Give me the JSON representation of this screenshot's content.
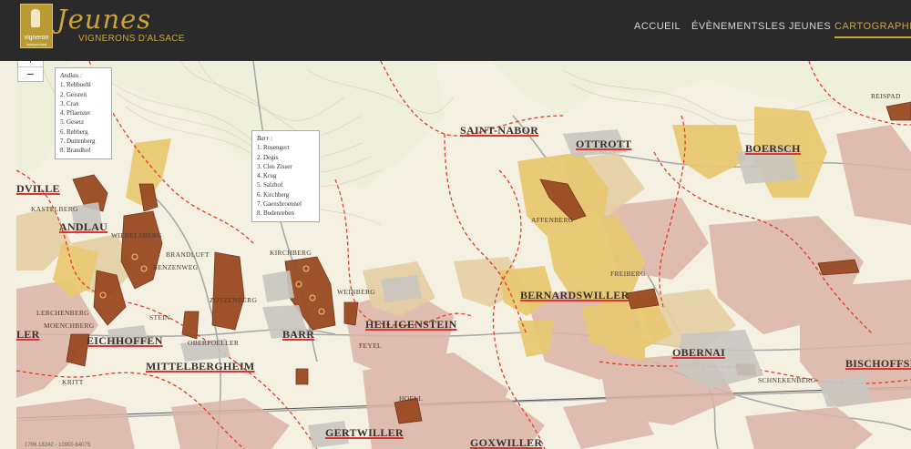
{
  "header": {
    "logo_line1": "vigneron",
    "logo_line2": "indépendant",
    "brand_title": "Jeunes",
    "brand_subtitle": "VIGNERONS D'ALSACE",
    "nav": [
      {
        "label": "ACCUEIL",
        "active": false
      },
      {
        "label": "ÉVÈNEMENTS",
        "active": false
      },
      {
        "label": "LES JEUNES",
        "active": false
      },
      {
        "label": "CARTOGRAPHIE",
        "active": true
      }
    ],
    "accent_color": "#c9a43b"
  },
  "map": {
    "zoom_in": "+",
    "zoom_out": "−",
    "villages": [
      "DVILLE",
      "ANDLAU",
      "SAINT-NABOR",
      "OTTROTT",
      "BOERSCH",
      "BERNARDSWILLER",
      "HEILIGENSTEIN",
      "BARR",
      "EICHHOFFEN",
      "MITTELBERGHEIM",
      "OBERNAI",
      "BISCHOFFSH",
      "GERTWILLER",
      "GOXWILLER",
      "LER"
    ],
    "lieux_dits": [
      "KASTELBERG",
      "WIEBELSBERG",
      "BRANDLUFT",
      "BENZENWEG",
      "ZOTZENBERG",
      "MOENCHBERG",
      "LERCHENBERG",
      "STEIN",
      "OBERPOELLER",
      "KRITT",
      "KIRCHBERG",
      "WEINBERG",
      "FEYEL",
      "HOELL",
      "AFFENBERG",
      "FREIBERG",
      "SCHNEKENBERG",
      "REISPAD"
    ],
    "legend_andlau": {
      "title": "Andlau :",
      "items": [
        "1. Rebbuehl",
        "2. Geisreit",
        "3. Crax",
        "4. Pflaenzer",
        "5. Gesetz",
        "6. Rebberg",
        "7. Duttenberg",
        "8. Brandhof"
      ]
    },
    "legend_barr": {
      "title": "Barr :",
      "items": [
        "1. Rosengert",
        "2. Degis",
        "3. Clos Zisser",
        "4. Krug",
        "5. Salzhof",
        "6. Kirchberg",
        "7. Gaensbroennel",
        "8. Bodenreben"
      ]
    },
    "coords_text": "1796 18242 - 10955 84075",
    "colors": {
      "grand_cru": "#9a4a22",
      "lieu_dit": "#e8c872",
      "commune_border": "#e23b2a",
      "vine_pink": "#dcb4a8",
      "vine_tan": "#e4cfa3"
    }
  }
}
